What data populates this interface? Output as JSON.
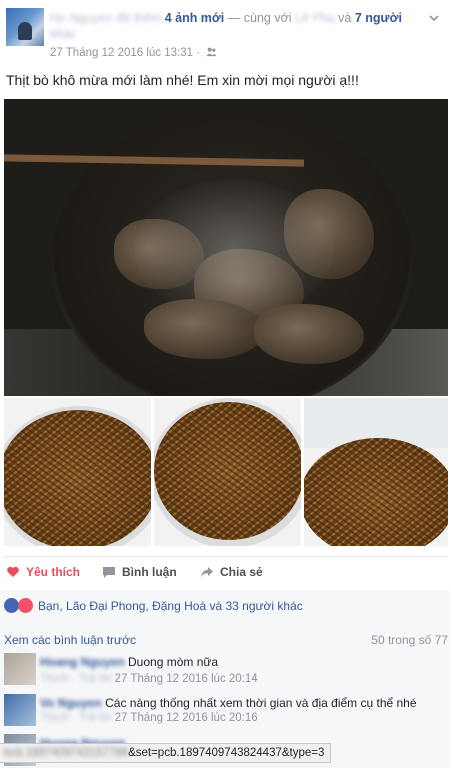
{
  "header": {
    "author": "Ho Nguyen",
    "added_text": "đã thêm",
    "photo_count": "4 ảnh mới",
    "with_text": "— cùng với",
    "tagged_person": "Lê Phu",
    "and_text": "và",
    "others_count": "7 người",
    "others_suffix": "khác",
    "timestamp": "27 Tháng 12 2016 lúc 13:31 ·"
  },
  "post": {
    "text": "Thịt bò khô mừa mới làm nhé! Em xin mời mọi người ạ!!!"
  },
  "actions": {
    "like": "Yêu thích",
    "comment": "Bình luận",
    "share": "Chia sẻ"
  },
  "reactions": {
    "summary": "Bạn, Lão Đại Phong, Đặng Hoà và 33 người khác"
  },
  "comments": {
    "view_previous": "Xem các bình luận trước",
    "count": "50 trong số 77",
    "items": [
      {
        "author": "Hoang Nguyen",
        "text": "Duong mòm nữa",
        "reply": "Thích · Trả lời",
        "time": "27 Tháng 12 2016 lúc 20:14"
      },
      {
        "author": "Vo Nguyen",
        "text": "Các nàng thống nhất xem thời gian và địa điểm cụ thể nhé",
        "reply": "Thích · Trả lời",
        "time": "27 Tháng 12 2016 lúc 20:16"
      },
      {
        "author": "Huong Nguyen",
        "text": "",
        "reply": "",
        "time": ""
      }
    ]
  },
  "status_bar": {
    "url_hidden": "bcb.1897409743157788",
    "url_visible": "&set=pcb.1897409743824437&type=3"
  },
  "colors": {
    "link": "#365899",
    "like_red": "#e54f5f",
    "muted": "#90949c",
    "panel": "#f6f7f9"
  }
}
